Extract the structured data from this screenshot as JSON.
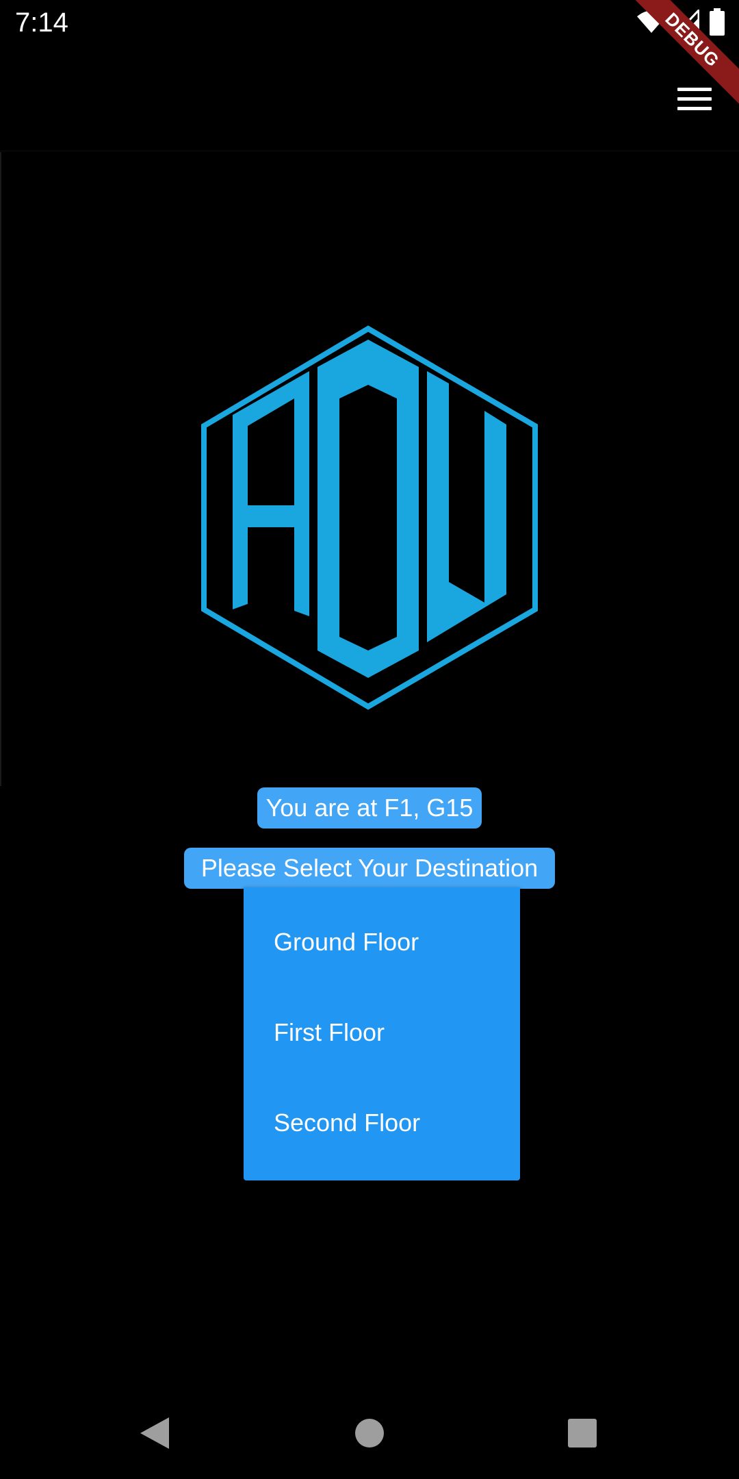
{
  "status_bar": {
    "time": "7:14",
    "icons": [
      "wifi-icon",
      "signal-icon",
      "battery-icon"
    ]
  },
  "debug_banner": {
    "label": "DEBUG",
    "color": "#8b1a1a"
  },
  "app_bar": {
    "menu_icon": "hamburger-menu-icon"
  },
  "logo": {
    "letters": "ADU",
    "color": "#1aa7e0"
  },
  "location": {
    "text": "You are at F1, G15"
  },
  "destination": {
    "prompt": "Please Select Your Destination",
    "options": [
      {
        "label": "Ground Floor"
      },
      {
        "label": "First Floor"
      },
      {
        "label": "Second Floor"
      }
    ]
  },
  "colors": {
    "chip_background": "#42a5f5",
    "dropdown_background": "#2196f3",
    "page_background": "#000000"
  },
  "nav_bar": {
    "icons": [
      "back-icon",
      "home-icon",
      "recent-apps-icon"
    ]
  }
}
